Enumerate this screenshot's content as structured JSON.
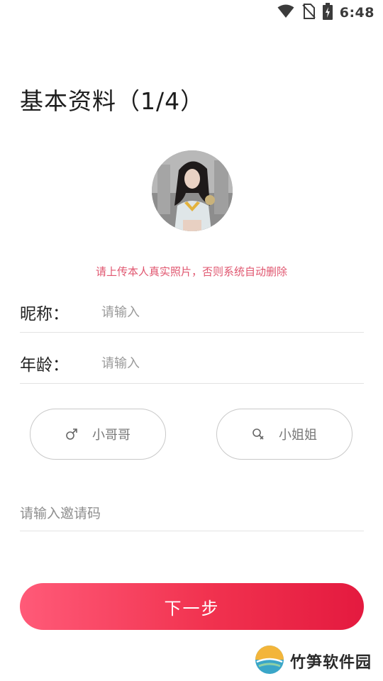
{
  "status_bar": {
    "time": "6:48",
    "icons": [
      "wifi-icon",
      "no-sim-icon",
      "battery-charging-icon"
    ]
  },
  "page": {
    "title": "基本资料（1/4）"
  },
  "avatar": {
    "icon": "user-photo"
  },
  "upload_hint": {
    "text": "请上传本人真实照片，否则系统自动删除",
    "color": "#e0566f"
  },
  "form": {
    "nickname": {
      "label": "昵称：",
      "placeholder": "请输入",
      "value": ""
    },
    "age": {
      "label": "年龄：",
      "placeholder": "请输入",
      "value": ""
    }
  },
  "gender": {
    "male": {
      "label": "小哥哥",
      "icon": "male-symbol-icon"
    },
    "female": {
      "label": "小姐姐",
      "icon": "female-symbol-icon"
    }
  },
  "invite": {
    "placeholder": "请输入邀请码",
    "value": ""
  },
  "next_button": {
    "label": "下一步",
    "gradient": [
      "#ff5a78",
      "#e41a3f"
    ]
  },
  "watermark": {
    "text": "竹笋软件园"
  }
}
